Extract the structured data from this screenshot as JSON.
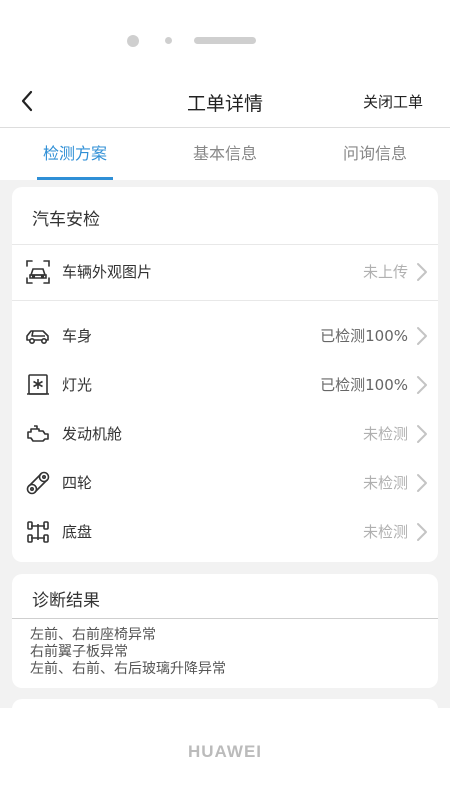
{
  "header": {
    "title": "工单详情",
    "action_label": "关闭工单",
    "back_icon": "chevron-left-icon"
  },
  "tabs": [
    {
      "label": "检测方案",
      "active": true
    },
    {
      "label": "基本信息",
      "active": false
    },
    {
      "label": "问询信息",
      "active": false
    }
  ],
  "inspection": {
    "title": "汽车安检",
    "photo_row": {
      "label": "车辆外观图片",
      "status": "未上传",
      "icon": "car-camera-icon"
    },
    "items": [
      {
        "label": "车身",
        "status": "已检测100%",
        "icon": "car-body-icon"
      },
      {
        "label": "灯光",
        "status": "已检测100%",
        "icon": "light-icon"
      },
      {
        "label": "发动机舱",
        "status": "未检测",
        "icon": "engine-icon"
      },
      {
        "label": "四轮",
        "status": "未检测",
        "icon": "wheel-icon"
      },
      {
        "label": "底盘",
        "status": "未检测",
        "icon": "chassis-icon"
      }
    ]
  },
  "diagnosis": {
    "title": "诊断结果",
    "lines": [
      "左前、右前座椅异常",
      "右前翼子板异常",
      "左前、右前、右后玻璃升降异常"
    ]
  },
  "device": {
    "brand": "HUAWEI"
  },
  "colors": {
    "accent": "#2f8fd6",
    "background": "#f2f2f2",
    "muted_text": "#b0b0b0"
  }
}
